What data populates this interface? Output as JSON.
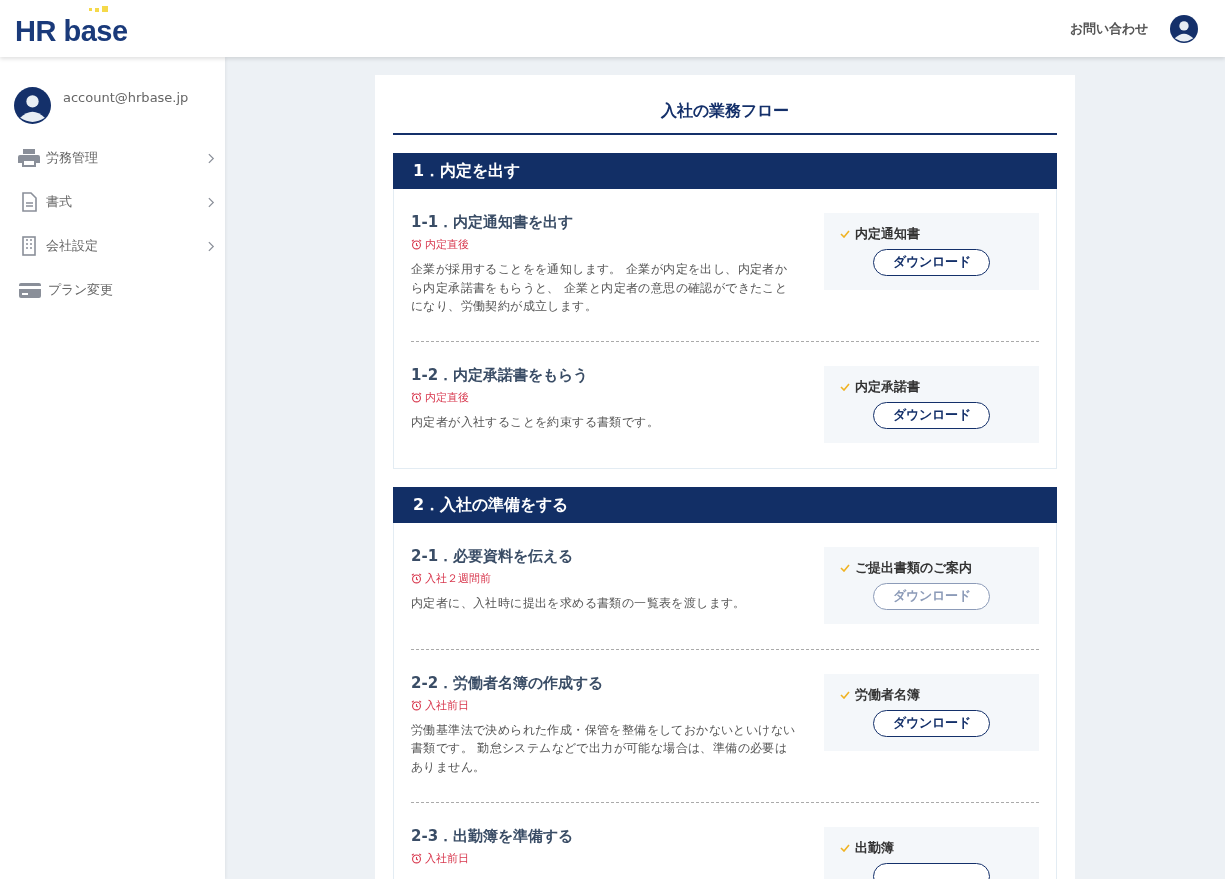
{
  "header": {
    "logo": "HR base",
    "contact_link": "お問い合わせ"
  },
  "sidebar": {
    "account": "account@hrbase.jp",
    "items": [
      {
        "kind": "printer",
        "label": "労務管理",
        "has_submenu": true
      },
      {
        "kind": "document",
        "label": "書式",
        "has_submenu": true
      },
      {
        "kind": "building",
        "label": "会社設定",
        "has_submenu": true
      },
      {
        "kind": "card",
        "label": "プラン変更",
        "has_submenu": false
      }
    ]
  },
  "page": {
    "title": "入社の業務フロー",
    "sections": [
      {
        "title": "1．内定を出す",
        "items": [
          {
            "title": "1-1．内定通知書を出す",
            "timing": "内定直後",
            "description": "企業が採用することをを通知します。 企業が内定を出し、内定者から内定承諾書をもらうと、 企業と内定者の意思の確認ができたことになり、労働契約が成立します。",
            "document": "内定通知書",
            "button": {
              "label": "ダウンロード",
              "disabled": false
            }
          },
          {
            "title": "1-2．内定承諾書をもらう",
            "timing": "内定直後",
            "description": "内定者が入社することを約束する書類です。",
            "document": "内定承諾書",
            "button": {
              "label": "ダウンロード",
              "disabled": false
            }
          }
        ]
      },
      {
        "title": "2．入社の準備をする",
        "items": [
          {
            "title": "2-1．必要資料を伝える",
            "timing": "入社２週間前",
            "description": "内定者に、入社時に提出を求める書類の一覧表を渡します。",
            "document": "ご提出書類のご案内",
            "button": {
              "label": "ダウンロード",
              "disabled": true
            }
          },
          {
            "title": "2-2．労働者名簿の作成する",
            "timing": "入社前日",
            "description": "労働基準法で決められた作成・保管を整備をしておかないといけない書類です。 勤怠システムなどで出力が可能な場合は、準備の必要はありません。",
            "document": "労働者名簿",
            "button": {
              "label": "ダウンロード",
              "disabled": false
            }
          },
          {
            "title": "2-3．出勤簿を準備する",
            "timing": "入社前日",
            "document": "出勤簿",
            "button": {
              "disabled": false
            }
          }
        ]
      }
    ]
  }
}
